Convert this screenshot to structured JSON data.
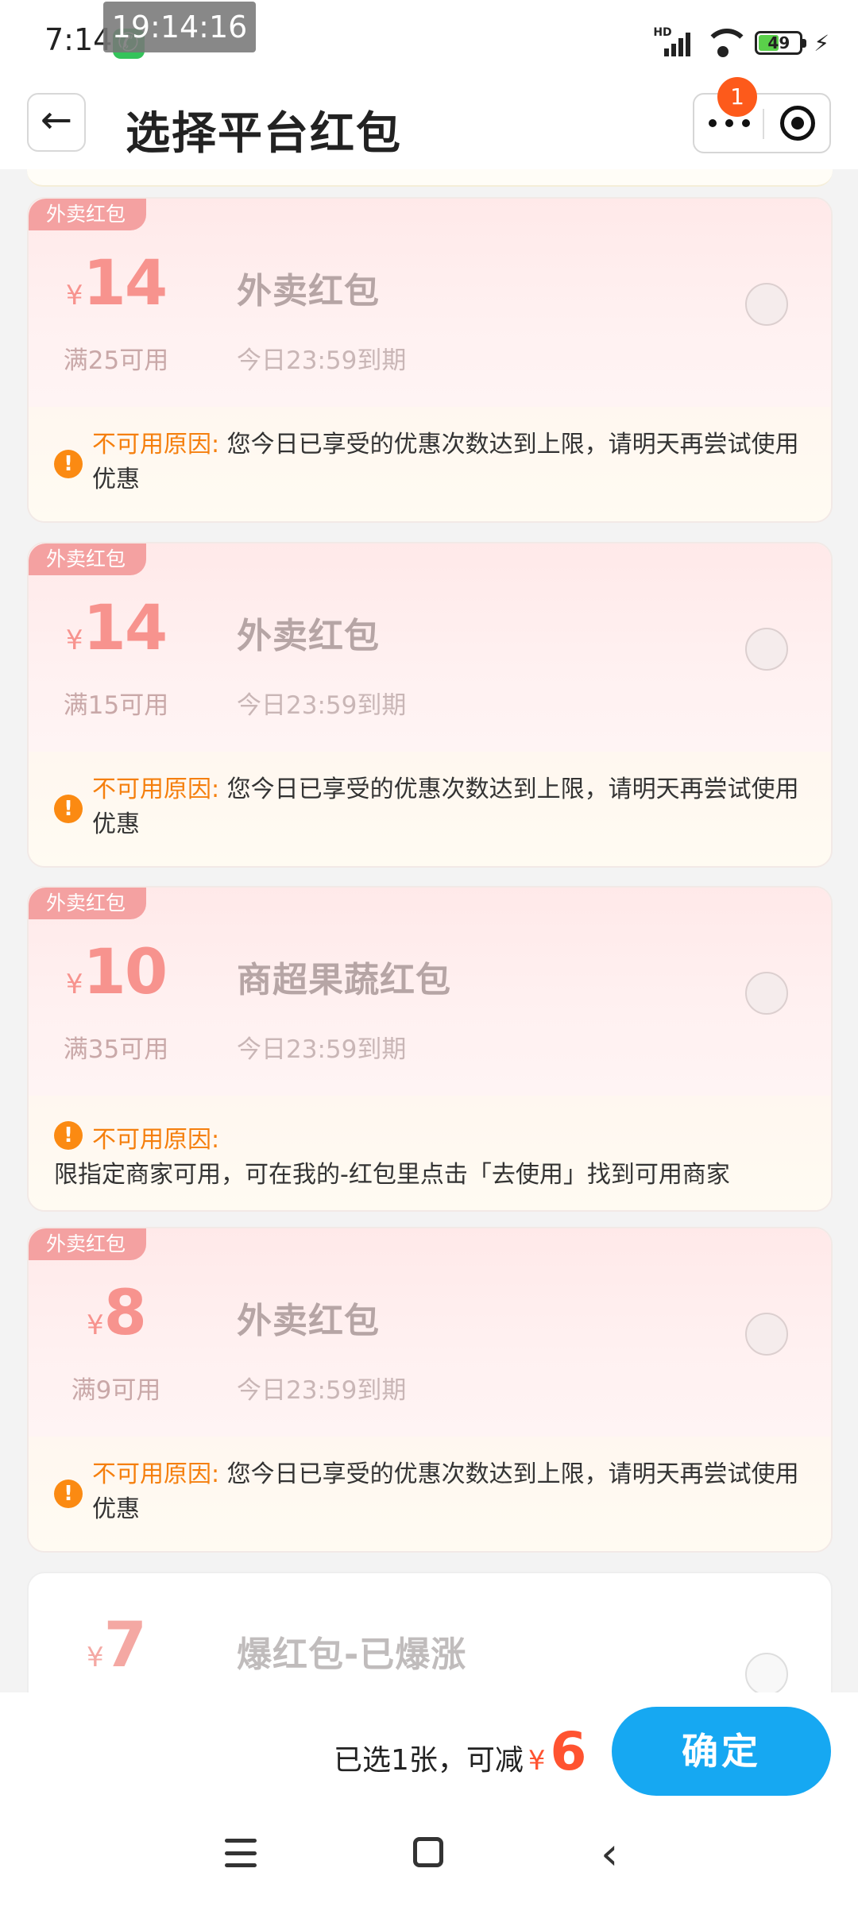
{
  "status_bar": {
    "time": "7:14",
    "overlay_clock": "19:14:16",
    "network": "HD",
    "battery": "49",
    "battery_level": 0.49
  },
  "header": {
    "title": "选择平台红包",
    "notification_count": "1"
  },
  "coupons": [
    {
      "tag": "外卖红包",
      "currency": "¥",
      "amount": "14",
      "threshold": "满25可用",
      "name": "外卖红包",
      "expire": "今日23:59到期",
      "reason_label": "不可用原因:",
      "reason_text": "您今日已享受的优惠次数达到上限，请明天再尝试使用优惠"
    },
    {
      "tag": "外卖红包",
      "currency": "¥",
      "amount": "14",
      "threshold": "满15可用",
      "name": "外卖红包",
      "expire": "今日23:59到期",
      "reason_label": "不可用原因:",
      "reason_text": "您今日已享受的优惠次数达到上限，请明天再尝试使用优惠"
    },
    {
      "tag": "外卖红包",
      "currency": "¥",
      "amount": "10",
      "threshold": "满35可用",
      "name": "商超果蔬红包",
      "expire": "今日23:59到期",
      "reason_label": "不可用原因:",
      "reason_text": "限指定商家可用，可在我的-红包里点击「去使用」找到可用商家"
    },
    {
      "tag": "外卖红包",
      "currency": "¥",
      "amount": "8",
      "threshold": "满9可用",
      "name": "外卖红包",
      "expire": "今日23:59到期",
      "reason_label": "不可用原因:",
      "reason_text": "您今日已享受的优惠次数达到上限，请明天再尝试使用优惠"
    },
    {
      "currency": "¥",
      "amount": "7",
      "name": "爆红包-已爆涨"
    }
  ],
  "footer": {
    "summary_text": "已选1张，可减",
    "currency": "¥",
    "discount_value": "6",
    "confirm_label": "确定"
  },
  "colors": {
    "accent_blue": "#16a8f2",
    "price_red": "#ff5330",
    "warning_orange": "#fb8a12",
    "tag_pink": "#f4a1a1"
  }
}
